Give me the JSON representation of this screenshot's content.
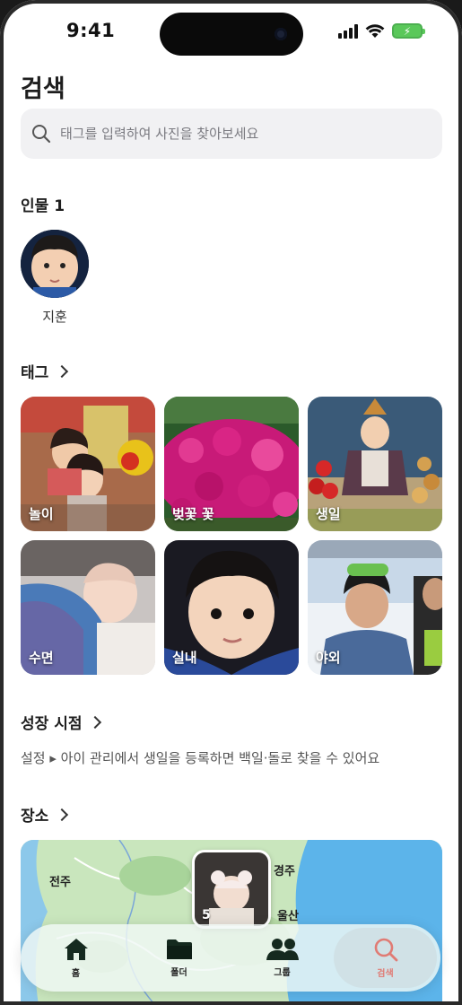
{
  "status_bar": {
    "time": "9:41"
  },
  "page_title": "검색",
  "search": {
    "placeholder": "태그를 입력하여 사진을 찾아보세요"
  },
  "people": {
    "title": "인물 1",
    "items": [
      {
        "name": "지훈"
      }
    ]
  },
  "tags": {
    "title": "태그",
    "items": [
      {
        "label": "놀이"
      },
      {
        "label": "벚꽃 꽃"
      },
      {
        "label": "생일"
      },
      {
        "label": "수면"
      },
      {
        "label": "실내"
      },
      {
        "label": "야외"
      }
    ]
  },
  "growth": {
    "title": "성장 시점",
    "hint": "설정 ▸ 아이 관리에서 생일을 등록하면 백일·돌로 찾을 수 있어요"
  },
  "places": {
    "title": "장소",
    "map_labels": {
      "jeonju": "전주",
      "ulsan": "울산",
      "gyeongju_partial": "경주"
    },
    "cluster_count": "5"
  },
  "tab_bar": {
    "items": [
      {
        "label": "홈",
        "icon": "home-icon"
      },
      {
        "label": "폴더",
        "icon": "folder-icon"
      },
      {
        "label": "그룹",
        "icon": "group-icon"
      },
      {
        "label": "검색",
        "icon": "search-icon"
      }
    ],
    "active_color": "#e07b74"
  }
}
